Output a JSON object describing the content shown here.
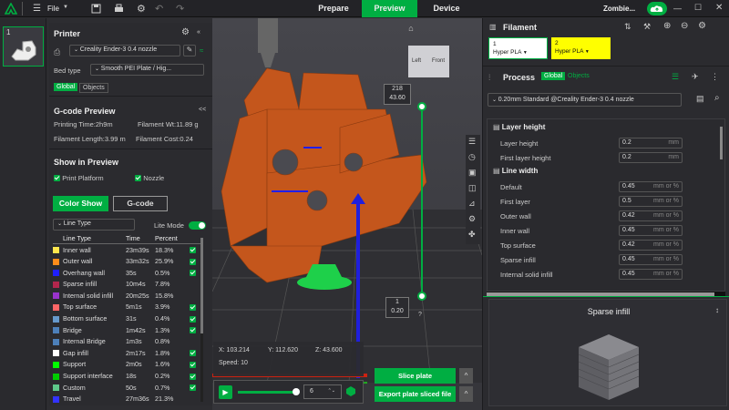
{
  "topbar": {
    "file_label": "File",
    "tabs": [
      "Prepare",
      "Preview",
      "Device"
    ],
    "user": "Zombie..."
  },
  "plate": {
    "number": "1"
  },
  "printer": {
    "title": "Printer",
    "name": "Creality Ender-3 0.4 nozzle",
    "bed_type_label": "Bed type",
    "bed_type": "Smooth PEI Plate / Hig...",
    "tab_global": "Global",
    "tab_objects": "Objects"
  },
  "gcode": {
    "title": "G-code Preview",
    "print_time": "Printing Time:2h9m",
    "filament_wt": "Filament Wt:11.89 g",
    "filament_len": "Filament Length:3.99 m",
    "filament_cost": "Filament Cost:0.24",
    "collapse": "<<"
  },
  "show": {
    "title": "Show in Preview",
    "print_platform": "Print Platform",
    "nozzle": "Nozzle",
    "color_show": "Color Show",
    "gcode_btn": "G-code",
    "line_type": "Line Type",
    "lite_mode": "Lite Mode"
  },
  "legend": {
    "headers": [
      "Line Type",
      "Time",
      "Percent"
    ],
    "rows": [
      {
        "name": "Inner wall",
        "time": "23m39s",
        "pct": "18.3%",
        "color": "#ffe64d",
        "checked": true
      },
      {
        "name": "Outer wall",
        "time": "33m32s",
        "pct": "25.9%",
        "color": "#ff8c1a",
        "checked": true
      },
      {
        "name": "Overhang wall",
        "time": "35s",
        "pct": "0.5%",
        "color": "#1f1fff",
        "checked": true
      },
      {
        "name": "Sparse infill",
        "time": "10m4s",
        "pct": "7.8%",
        "color": "#b3264d",
        "checked": false
      },
      {
        "name": "Internal solid infill",
        "time": "20m25s",
        "pct": "15.8%",
        "color": "#9933cc",
        "checked": false
      },
      {
        "name": "Top surface",
        "time": "5m1s",
        "pct": "3.9%",
        "color": "#ff6666",
        "checked": true
      },
      {
        "name": "Bottom surface",
        "time": "31s",
        "pct": "0.4%",
        "color": "#6699cc",
        "checked": true
      },
      {
        "name": "Bridge",
        "time": "1m42s",
        "pct": "1.3%",
        "color": "#4d80ba",
        "checked": true
      },
      {
        "name": "Internal Bridge",
        "time": "1m3s",
        "pct": "0.8%",
        "color": "#4d80ba",
        "checked": false
      },
      {
        "name": "Gap infill",
        "time": "2m17s",
        "pct": "1.8%",
        "color": "#ffffff",
        "checked": true
      },
      {
        "name": "Support",
        "time": "2m0s",
        "pct": "1.6%",
        "color": "#00ff00",
        "checked": true
      },
      {
        "name": "Support interface",
        "time": "18s",
        "pct": "0.2%",
        "color": "#00cc00",
        "checked": true
      },
      {
        "name": "Custom",
        "time": "50s",
        "pct": "0.7%",
        "color": "#5ec98a",
        "checked": true
      },
      {
        "name": "Travel",
        "time": "27m36s",
        "pct": "21.3%",
        "color": "#3333ff",
        "checked": false
      }
    ]
  },
  "viewport": {
    "layer_top": "218",
    "height_top": "43.60",
    "layer_bot": "1",
    "height_bot": "0.20",
    "help": "?",
    "cube_left": "Left",
    "cube_front": "Front",
    "coords": {
      "x": "X: 103.214",
      "y": "Y: 112.620",
      "z": "Z: 43.600",
      "speed": "Speed: 10"
    },
    "step": "6",
    "slice_plate": "Slice plate",
    "export": "Export plate sliced file",
    "caret": "^"
  },
  "filament": {
    "title": "Filament",
    "slots": [
      {
        "num": "1",
        "name": "Hyper PLA",
        "color": "#ffffff"
      },
      {
        "num": "2",
        "name": "Hyper PLA",
        "color": "#ffff00"
      }
    ]
  },
  "process": {
    "title": "Process",
    "tab_global": "Global",
    "tab_objects": "Objects",
    "preset": "0.20mm Standard @Creality Ender-3 0.4 nozzle",
    "groups": [
      {
        "name": "Layer height",
        "rows": [
          {
            "label": "Layer height",
            "value": "0.2",
            "unit": "mm"
          },
          {
            "label": "First layer height",
            "value": "0.2",
            "unit": "mm"
          }
        ]
      },
      {
        "name": "Line width",
        "rows": [
          {
            "label": "Default",
            "value": "0.45",
            "unit": "mm or %"
          },
          {
            "label": "First layer",
            "value": "0.5",
            "unit": "mm or %"
          },
          {
            "label": "Outer wall",
            "value": "0.42",
            "unit": "mm or %"
          },
          {
            "label": "Inner wall",
            "value": "0.45",
            "unit": "mm or %"
          },
          {
            "label": "Top surface",
            "value": "0.42",
            "unit": "mm or %"
          },
          {
            "label": "Sparse infill",
            "value": "0.45",
            "unit": "mm or %"
          },
          {
            "label": "Internal solid infill",
            "value": "0.45",
            "unit": "mm or %"
          }
        ]
      }
    ]
  },
  "preview_card": {
    "title": "Sparse infill",
    "chevron": "↕"
  }
}
